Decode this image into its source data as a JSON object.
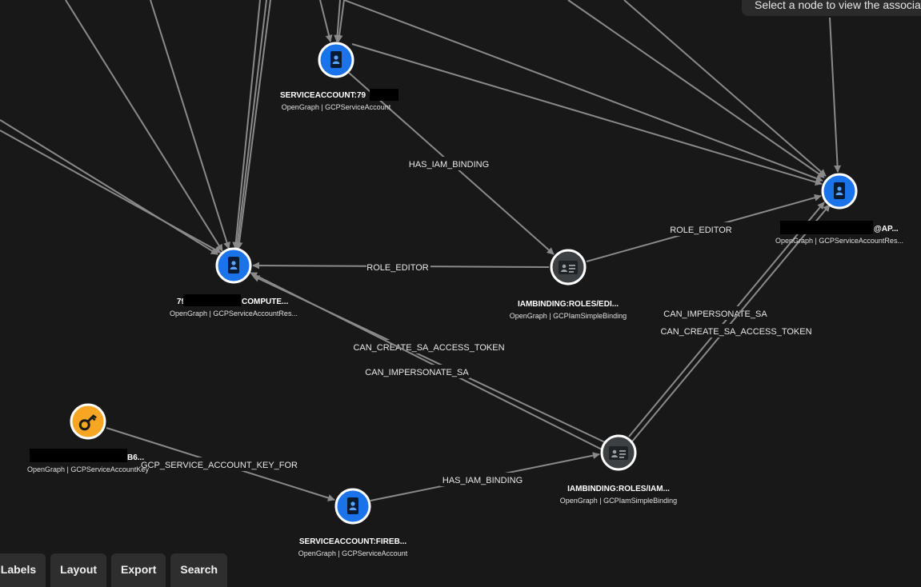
{
  "tooltip": {
    "text": "Select a node to view the associated"
  },
  "toolbar": {
    "labels_button": "ode Labels",
    "layout_button": "Layout",
    "export_button": "Export",
    "search_button": "Search"
  },
  "edges": {
    "has_iam_binding_1": "HAS_IAM_BINDING",
    "role_editor_1": "ROLE_EDITOR",
    "role_editor_2": "ROLE_EDITOR",
    "can_create_sa_access_token_1": "CAN_CREATE_SA_ACCESS_TOKEN",
    "can_impersonate_sa_1": "CAN_IMPERSONATE_SA",
    "can_impersonate_sa_2": "CAN_IMPERSONATE_SA",
    "can_create_sa_access_token_2": "CAN_CREATE_SA_ACCESS_TOKEN",
    "gcp_service_account_key_for": "GCP_SERVICE_ACCOUNT_KEY_FOR",
    "has_iam_binding_2": "HAS_IAM_BINDING"
  },
  "nodes": {
    "sa_top": {
      "title": "SERVICEACCOUNT:79",
      "subtitle": "OpenGraph | GCPServiceAccount"
    },
    "compute_sa": {
      "title_prefix": "79",
      "title_suffix": "COMPUTE...",
      "subtitle": "OpenGraph | GCPServiceAccountRes..."
    },
    "ap_sa": {
      "title_suffix": "@AP...",
      "subtitle": "OpenGraph | GCPServiceAccountRes..."
    },
    "binding_editor": {
      "title": "IAMBINDING:ROLES/EDI...",
      "subtitle": "OpenGraph | GCPIamSimpleBinding"
    },
    "binding_iam": {
      "title": "IAMBINDING:ROLES/IAM...",
      "subtitle": "OpenGraph | GCPIamSimpleBinding"
    },
    "sa_key": {
      "title_suffix": "B6...",
      "subtitle": "OpenGraph | GCPServiceAccountKey"
    },
    "sa_fireb": {
      "title": "SERVICEACCOUNT:FIREB...",
      "subtitle": "OpenGraph | GCPServiceAccount"
    }
  },
  "colors": {
    "background": "#181818",
    "edge": "#8a8a8a",
    "service_account_node": "#1a73e8",
    "binding_node": "#3c4043",
    "key_node": "#f6a623"
  },
  "icons": {
    "service_account": "person-badge-icon",
    "binding": "id-card-icon",
    "key": "key-icon"
  }
}
